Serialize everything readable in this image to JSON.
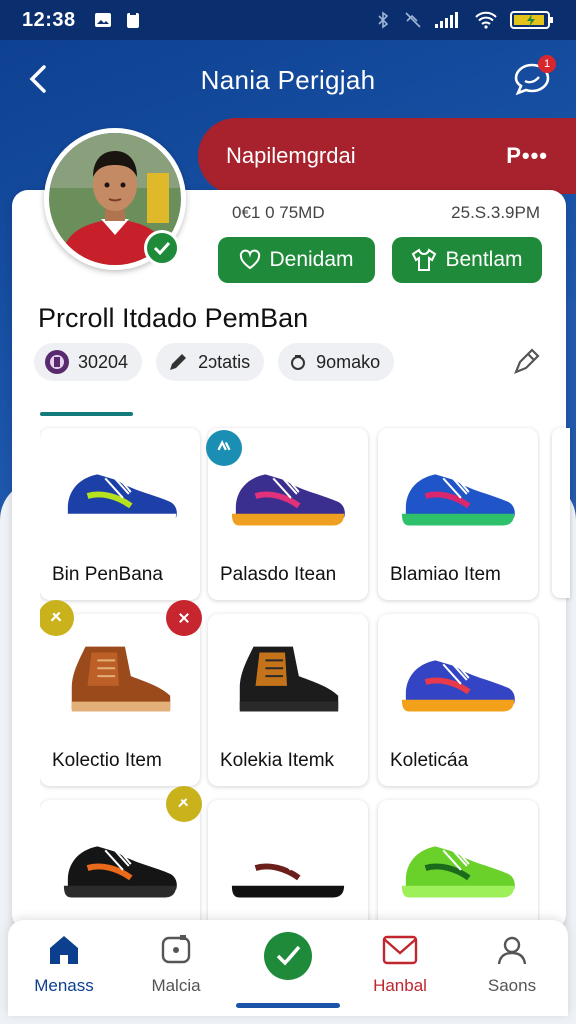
{
  "status_bar": {
    "time": "12:38"
  },
  "header": {
    "title": "Nania Perigjah",
    "notification_count": "1"
  },
  "banner": {
    "name": "Napilemgrdai",
    "more": "P•••"
  },
  "profile": {
    "stat_left": "0€1 0 75MD",
    "stat_right": "25.S.3.9PM",
    "button_primary": "Denidam",
    "button_secondary": "Bentlam",
    "name": "Prcroll Itdado PemBan",
    "chips": [
      {
        "icon": "badge-icon",
        "label": "30204"
      },
      {
        "icon": "pencil-icon",
        "label": "2ɔtatis"
      },
      {
        "icon": "ring-icon",
        "label": "9omako"
      }
    ]
  },
  "items": [
    {
      "label": "Bin PenBana",
      "colors": [
        "#1d3fa8",
        "#b6e11e",
        "#ffffff"
      ]
    },
    {
      "label": "Palasdo Itean",
      "colors": [
        "#3a2f8f",
        "#e0317a",
        "#f0a020"
      ]
    },
    {
      "label": "Blamiao Item",
      "colors": [
        "#1f55c8",
        "#d9266d",
        "#2fc06b"
      ]
    },
    {
      "label": "Kolectio Item",
      "colors": [
        "#9b4a1c",
        "#c5652a",
        "#e3b07a"
      ]
    },
    {
      "label": "Kolekia Itemk",
      "colors": [
        "#1c1c1c",
        "#f08a1a",
        "#2a2a2a"
      ]
    },
    {
      "label": "Koleticáa",
      "colors": [
        "#3344c4",
        "#e83a4a",
        "#f3a11a"
      ]
    },
    {
      "label": "",
      "colors": [
        "#151515",
        "#e86a1a",
        "#2b2b2b"
      ]
    },
    {
      "label": "",
      "colors": [
        "#ffffff",
        "#6a1f1a",
        "#111111"
      ]
    },
    {
      "label": "",
      "colors": [
        "#69d12a",
        "#1c6a1c",
        "#9ef05a"
      ]
    }
  ],
  "bottom_nav": [
    {
      "label": "Menass",
      "icon": "home-icon"
    },
    {
      "label": "Malcia",
      "icon": "media-icon"
    },
    {
      "label": "",
      "icon": "check-icon"
    },
    {
      "label": "Hanbal",
      "icon": "mail-icon"
    },
    {
      "label": "Saons",
      "icon": "user-icon"
    }
  ],
  "colors": {
    "primary": "#0d3f8f",
    "green": "#1f8a3a",
    "red": "#a7222c"
  }
}
